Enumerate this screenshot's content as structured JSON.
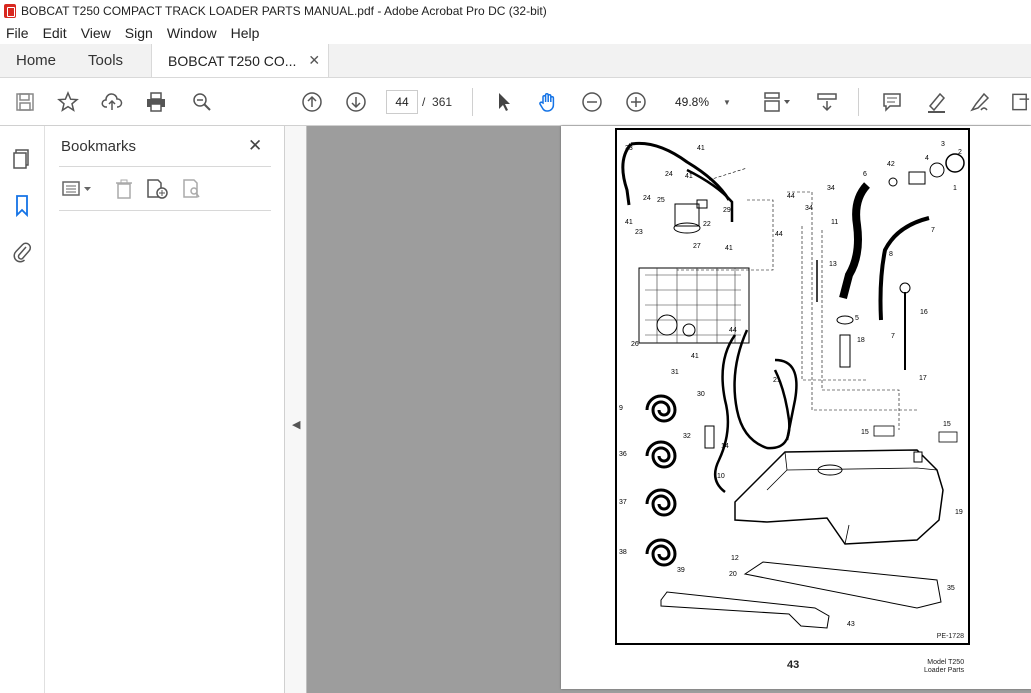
{
  "window": {
    "title": "BOBCAT T250 COMPACT TRACK LOADER PARTS MANUAL.pdf - Adobe Acrobat Pro DC (32-bit)"
  },
  "menu": {
    "items": [
      "File",
      "Edit",
      "View",
      "Sign",
      "Window",
      "Help"
    ]
  },
  "tabs": {
    "home": "Home",
    "tools": "Tools",
    "document": "BOBCAT T250 CO...",
    "close": "✕"
  },
  "toolbar": {
    "page_current": "44",
    "page_separator": "/",
    "page_total": "361",
    "zoom": "49.8%"
  },
  "bookmarks": {
    "title": "Bookmarks",
    "close": "✕"
  },
  "page": {
    "number": "43",
    "footer_line1": "Model T250",
    "footer_line2": "Loader Parts",
    "figure_id": "PE-1728",
    "callouts": [
      "1",
      "2",
      "3",
      "4",
      "5",
      "6",
      "7",
      "8",
      "9",
      "10",
      "11",
      "12",
      "13",
      "14",
      "15",
      "16",
      "17",
      "18",
      "19",
      "20",
      "21",
      "22",
      "23",
      "24",
      "25",
      "26",
      "27",
      "28",
      "29",
      "30",
      "31",
      "32",
      "33",
      "34",
      "35",
      "36",
      "37",
      "38",
      "39",
      "41",
      "42",
      "43",
      "44"
    ]
  },
  "colors": {
    "accent": "#1473e6",
    "viewer_bg": "#9d9d9d",
    "acrobat_red": "#d8281f"
  }
}
